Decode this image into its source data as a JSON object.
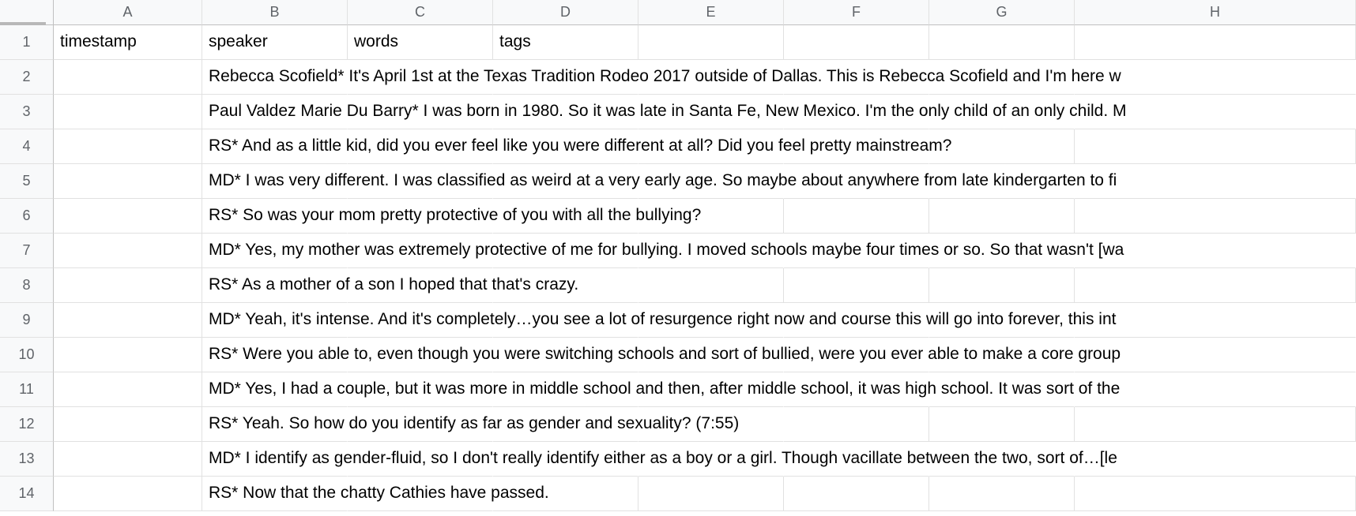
{
  "columns": [
    "A",
    "B",
    "C",
    "D",
    "E",
    "F",
    "G",
    "H"
  ],
  "header_row": {
    "A": "timestamp",
    "B": "speaker",
    "C": "words",
    "D": "tags"
  },
  "rows": [
    {
      "num": "1"
    },
    {
      "num": "2",
      "B": "Rebecca Scofield* It's April 1st at the Texas Tradition Rodeo 2017 outside of Dallas. This is Rebecca Scofield and I'm here w"
    },
    {
      "num": "3",
      "B": "Paul Valdez Marie Du Barry* I was born in 1980. So it was late in Santa Fe, New Mexico. I'm the only child of an only child. M"
    },
    {
      "num": "4",
      "B": "RS* And as a little kid, did you ever feel like you were different at all? Did you feel pretty mainstream?"
    },
    {
      "num": "5",
      "B": "MD* I was very different. I was classified as weird at a very early age. So maybe about anywhere from late kindergarten to fi"
    },
    {
      "num": "6",
      "B": "RS* So was your mom pretty protective of you with all the bullying?"
    },
    {
      "num": "7",
      "B": "MD* Yes, my mother was extremely protective of me for bullying. I moved schools maybe four times or so. So that wasn't [wa"
    },
    {
      "num": "8",
      "B": "RS* As a mother of a son I hoped that that's crazy."
    },
    {
      "num": "9",
      "B": "MD* Yeah, it's intense. And it's completely…you see a lot of resurgence right now and course this will go into forever, this int"
    },
    {
      "num": "10",
      "B": "RS* Were you able to, even though you were switching schools and sort of bullied, were you ever able to make a core group"
    },
    {
      "num": "11",
      "B": "MD* Yes, I had a couple, but it was more in middle school and then, after middle school, it was high school. It was sort of the"
    },
    {
      "num": "12",
      "B": "RS* Yeah. So how do you identify as far as gender and sexuality? (7:55)"
    },
    {
      "num": "13",
      "B": "MD* I identify as gender-fluid, so I don't really identify either as a boy or a girl. Though vacillate between the two, sort of…[le"
    },
    {
      "num": "14",
      "B": "RS* Now that the chatty Cathies have passed."
    }
  ]
}
